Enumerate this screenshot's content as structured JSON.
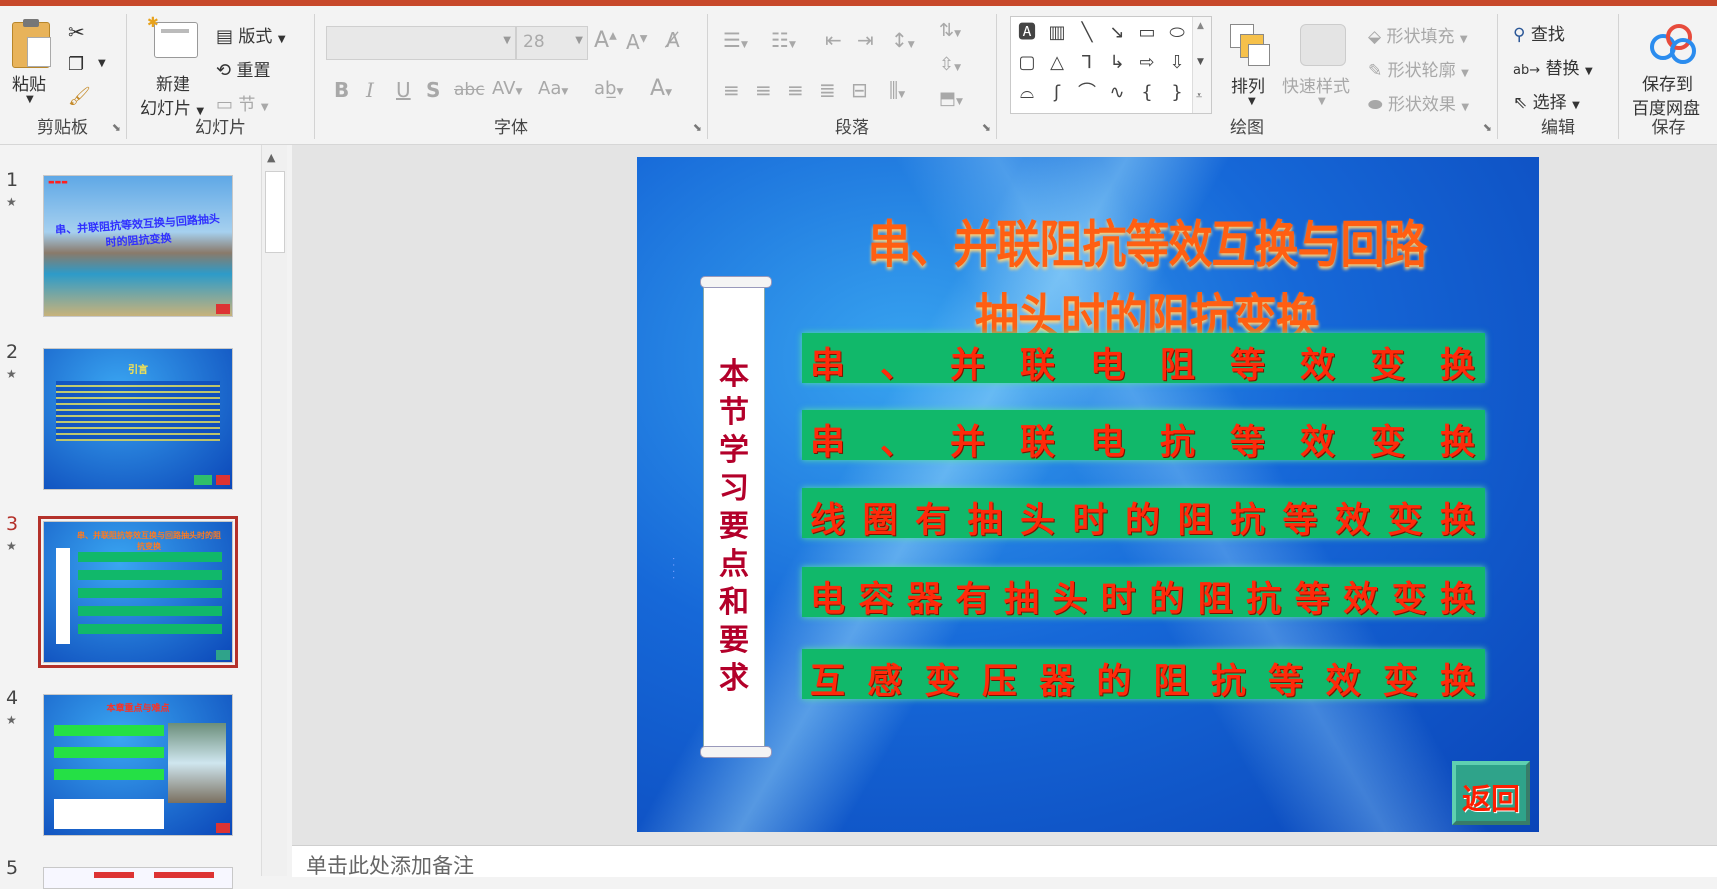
{
  "ribbon": {
    "clipboard": {
      "label": "剪贴板",
      "paste": "粘贴"
    },
    "slides": {
      "label": "幻灯片",
      "new_slide": "新建",
      "new_slide2": "幻灯片",
      "layout": "版式",
      "reset": "重置",
      "section": "节"
    },
    "font": {
      "label": "字体",
      "font_name": "",
      "font_size": "28"
    },
    "paragraph": {
      "label": "段落"
    },
    "drawing": {
      "label": "绘图",
      "arrange": "排列",
      "quick_styles": "快速样式",
      "shape_fill": "形状填充",
      "shape_outline": "形状轮廓",
      "shape_effects": "形状效果"
    },
    "editing": {
      "label": "编辑",
      "find": "查找",
      "replace": "替换",
      "select": "选择"
    },
    "save": {
      "label": "保存",
      "save_to": "保存到",
      "baidu": "百度网盘"
    }
  },
  "thumbnails": [
    {
      "num": "1",
      "title": "串、并联阻抗等效互换与回路抽头时的阻抗变换"
    },
    {
      "num": "2",
      "title": "引言"
    },
    {
      "num": "3",
      "title": "串、并联阻抗等效互换与回路抽头时的阻抗变换"
    },
    {
      "num": "4",
      "title": "本章重点与难点"
    },
    {
      "num": "5"
    }
  ],
  "slide": {
    "title": "串、并联阻抗等效互换与回路抽头时的阻抗变换",
    "scroll_text": "本节学习要点和要求",
    "items": [
      "串、并联电阻等效变换",
      "串、并联电抗等效变换",
      "线圈有抽头时的阻抗等效变换",
      "电容器有抽头时的阻抗等效变换",
      "互感变压器的阻抗等效变换"
    ],
    "back_button": "返回"
  },
  "notes": {
    "placeholder": "单击此处添加备注"
  },
  "colors": {
    "accent": "#c7482a",
    "row_green": "#11b86a",
    "text_red": "#ff2a0a",
    "title_orange": "#ff5f12"
  }
}
